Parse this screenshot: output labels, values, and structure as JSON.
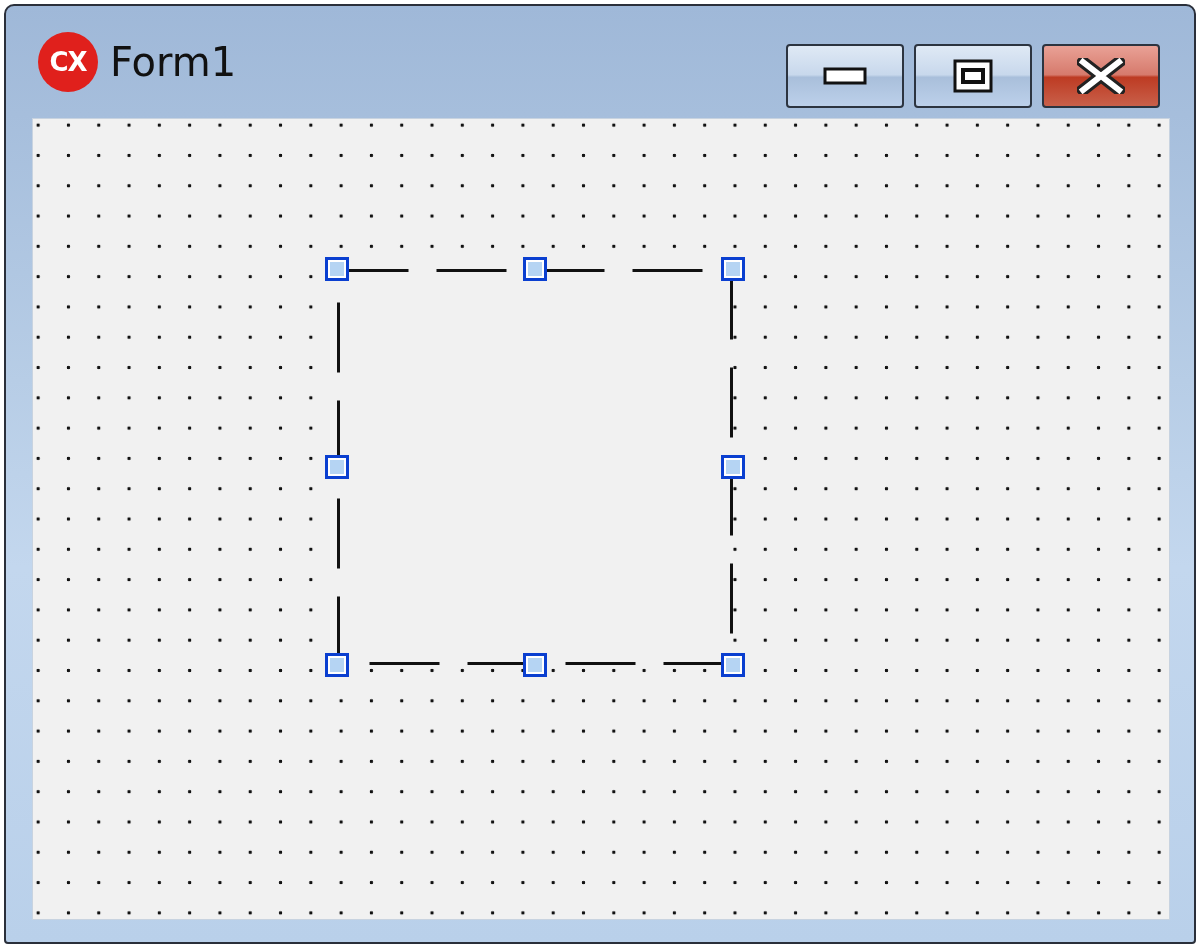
{
  "window": {
    "title": "Form1",
    "app_icon_text": "CX"
  },
  "form_surface": {
    "control": {
      "selected": true
    }
  }
}
